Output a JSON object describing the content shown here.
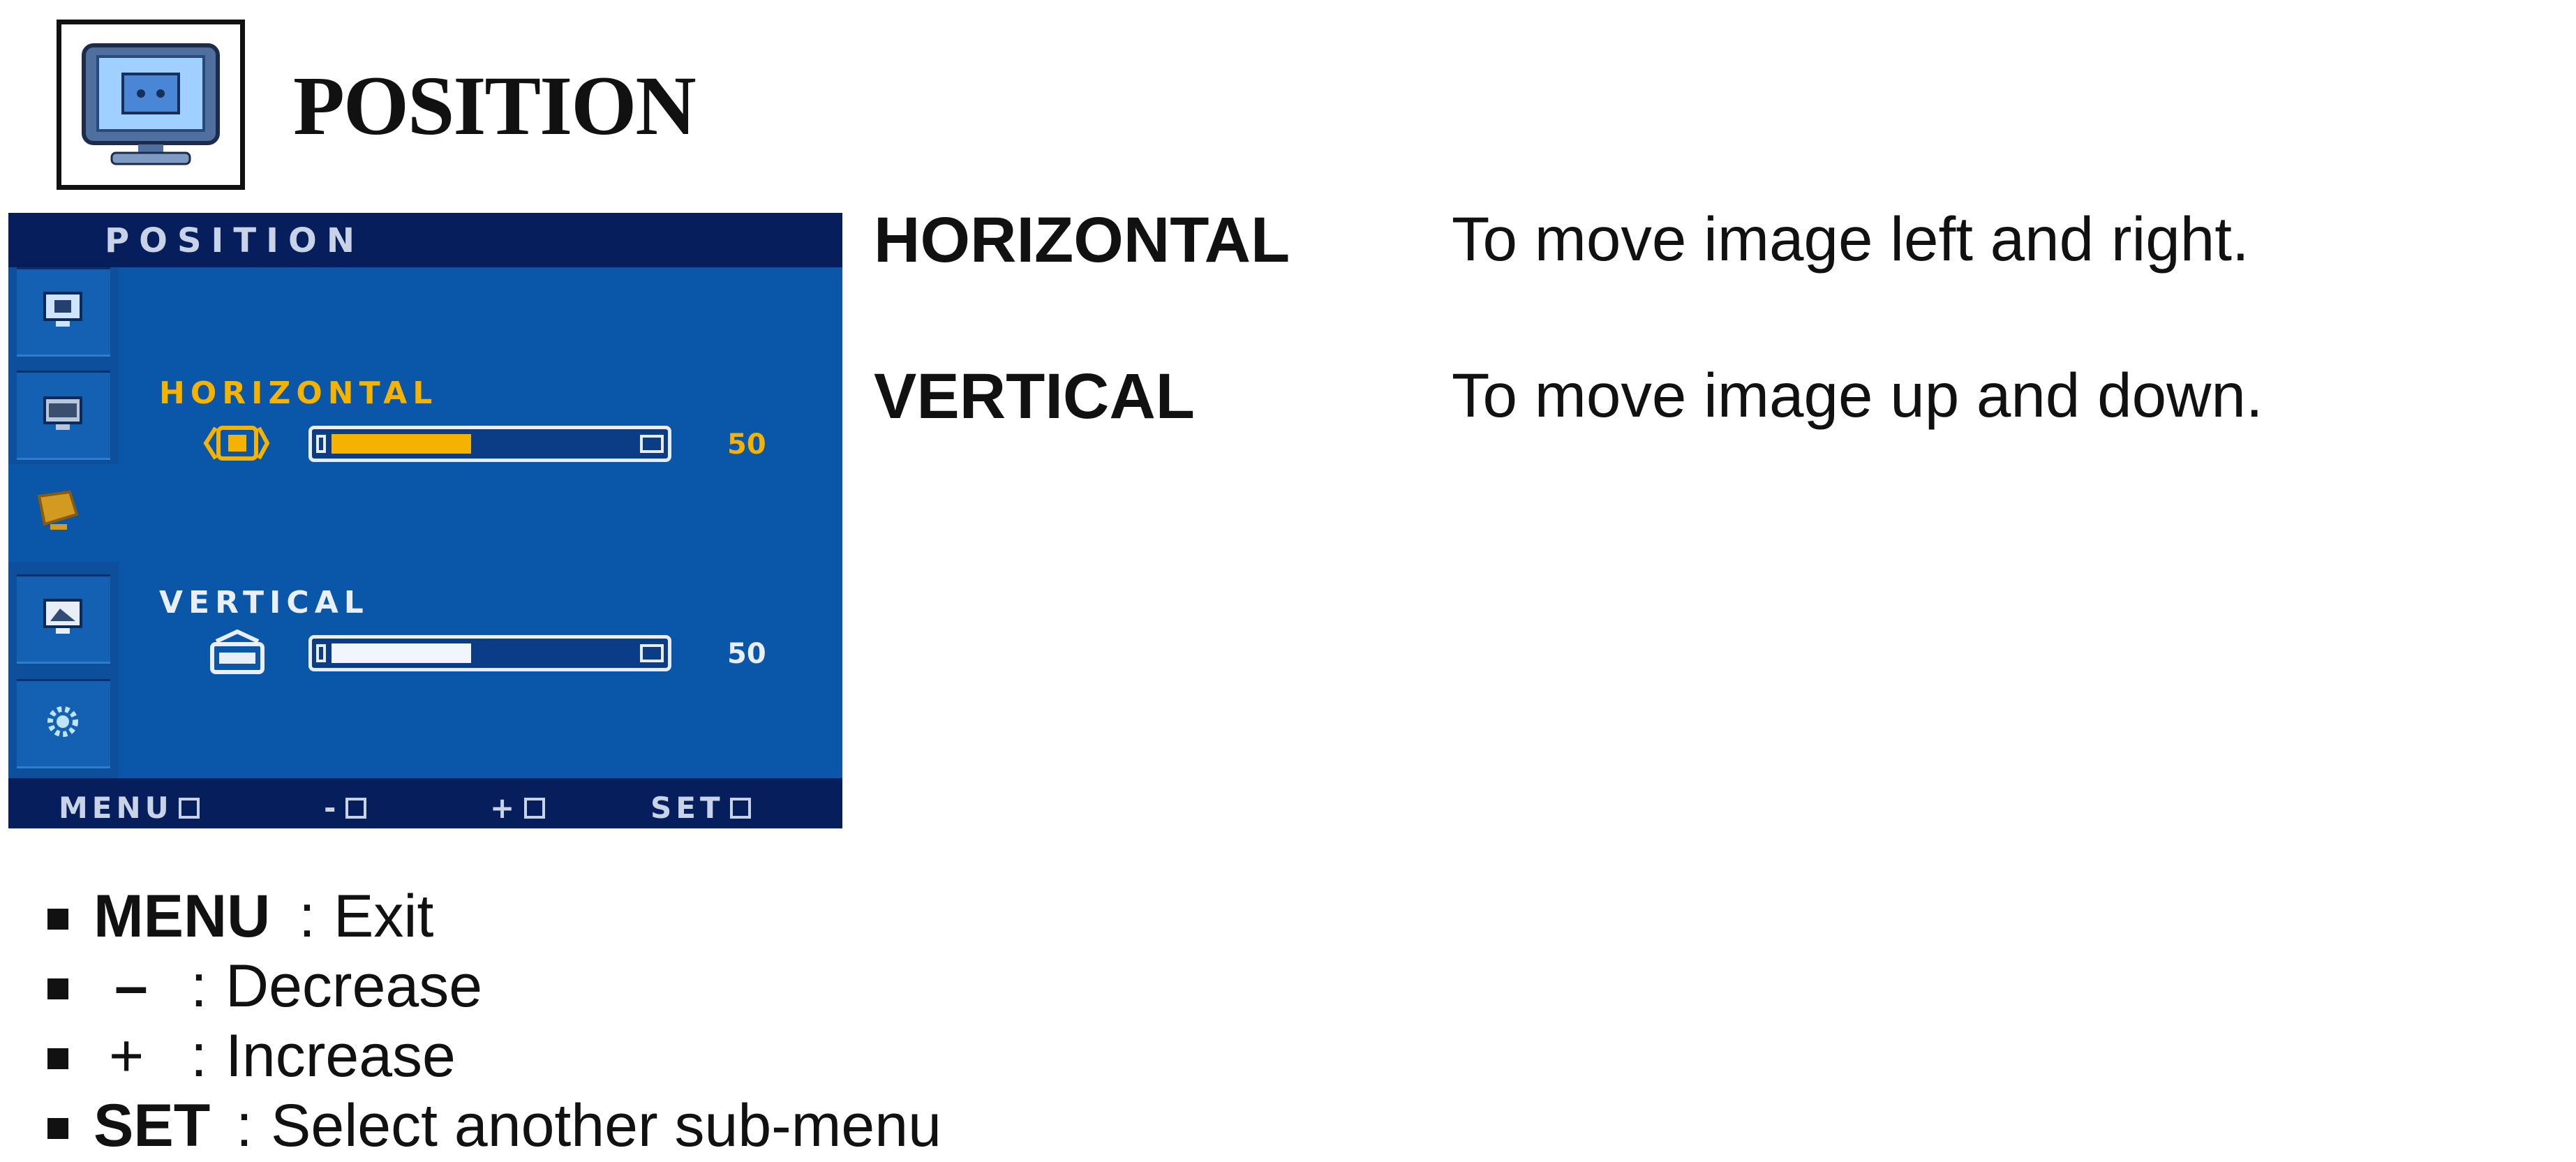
{
  "header": {
    "icon": "monitor-position-icon",
    "title": "POSITION"
  },
  "osd": {
    "title": "POSITION",
    "sidebar_icons": [
      "picture-icon",
      "color-icon",
      "position-icon",
      "tracking-icon",
      "setup-icon"
    ],
    "active_index": 2,
    "horizontal": {
      "label": "HORIZONTAL",
      "value": "50",
      "level": 0.5
    },
    "vertical": {
      "label": "VERTICAL",
      "value": "50",
      "level": 0.5
    },
    "bottom": {
      "menu": "MENU",
      "minus": "-",
      "plus": "+",
      "set": "SET"
    },
    "colors": {
      "panel": "#0a56a8",
      "bar": "#061f5c",
      "accent": "#f5b300"
    }
  },
  "descriptions": [
    {
      "term": "HORIZONTAL",
      "text": "To move image left and right."
    },
    {
      "term": "VERTICAL",
      "text": "To move image up and down."
    }
  ],
  "legend": [
    {
      "key": "MENU",
      "sep": ":",
      "desc": "Exit"
    },
    {
      "key": "–",
      "sep": ":",
      "desc": "Decrease"
    },
    {
      "key": "+",
      "sep": ":",
      "desc": "Increase"
    },
    {
      "key": "SET",
      "sep": ":",
      "desc": "Select another sub-menu"
    }
  ]
}
